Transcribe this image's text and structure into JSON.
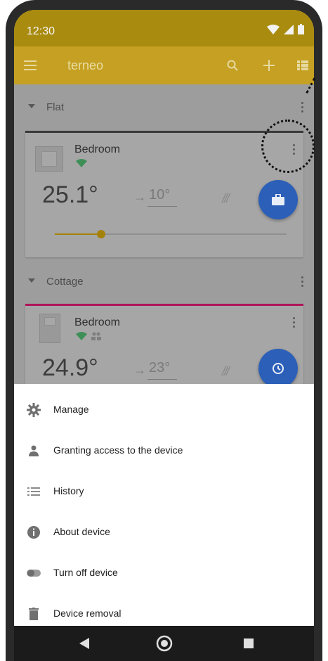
{
  "status_bar": {
    "time": "12:30"
  },
  "app_bar": {
    "title": "terneo"
  },
  "groups": [
    {
      "name": "Flat",
      "device": {
        "name": "Bedroom",
        "current_temp": "25.1°",
        "target_temp": "10°",
        "accent_color": "#3a3a3a",
        "slider_level": 0.2,
        "fab_icon": "briefcase-icon"
      }
    },
    {
      "name": "Cottage",
      "device": {
        "name": "Bedroom",
        "current_temp": "24.9°",
        "target_temp": "23°",
        "accent_color": "#b0145a",
        "fab_icon": "clock-icon"
      }
    }
  ],
  "menu": {
    "items": [
      {
        "label": "Manage",
        "icon": "gear-icon"
      },
      {
        "label": "Granting access to the device",
        "icon": "person-icon"
      },
      {
        "label": "History",
        "icon": "list-icon"
      },
      {
        "label": "About device",
        "icon": "info-icon"
      },
      {
        "label": "Turn off device",
        "icon": "toggle-icon"
      },
      {
        "label": "Device removal",
        "icon": "trash-icon"
      }
    ]
  },
  "colors": {
    "status_bar": "#a98b0f",
    "app_bar": "#c5a022",
    "fab": "#2b5fb8",
    "accent_gold": "#a4820a"
  }
}
